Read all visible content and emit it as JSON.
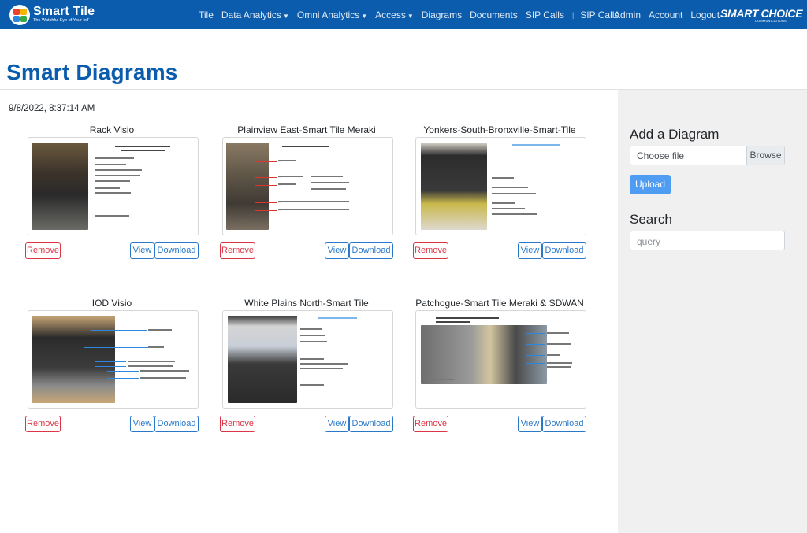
{
  "nav": {
    "brand_title": "Smart Tile",
    "brand_tagline": "The Watchful Eye of Your IoT",
    "links": [
      {
        "label": "Tile",
        "dropdown": false
      },
      {
        "label": "Data Analytics",
        "dropdown": true
      },
      {
        "label": "Omni Analytics",
        "dropdown": true
      },
      {
        "label": "Access",
        "dropdown": true
      },
      {
        "label": "Diagrams",
        "dropdown": false
      },
      {
        "label": "Documents",
        "dropdown": false
      },
      {
        "label": "SIP Calls",
        "dropdown": false
      },
      {
        "label": "SIP Calls",
        "dropdown": false
      }
    ],
    "right_links": [
      "Admin",
      "Account",
      "Logout"
    ],
    "partner_logo": "SMART CHOICE",
    "partner_sub": "COMMUNICATIONS"
  },
  "page": {
    "title": "Smart Diagrams",
    "timestamp": "9/8/2022, 8:37:14 AM"
  },
  "cards": [
    {
      "title": "Rack Visio",
      "remove": "Remove",
      "view": "View",
      "download": "Download"
    },
    {
      "title": "Plainview East-Smart Tile Meraki",
      "remove": "Remove",
      "view": "View",
      "download": "Download"
    },
    {
      "title": "Yonkers-South-Bronxville-Smart-Tile",
      "remove": "Remove",
      "view": "View",
      "download": "Download"
    },
    {
      "title": "IOD Visio",
      "remove": "Remove",
      "view": "View",
      "download": "Download"
    },
    {
      "title": "White Plains North-Smart Tile",
      "remove": "Remove",
      "view": "View",
      "download": "Download"
    },
    {
      "title": "Patchogue-Smart Tile Meraki & SDWAN",
      "remove": "Remove",
      "view": "View",
      "download": "Download"
    }
  ],
  "sidebar": {
    "add_heading": "Add a Diagram",
    "file_placeholder": "Choose file",
    "browse_label": "Browse",
    "upload_label": "Upload",
    "search_heading": "Search",
    "search_placeholder": "query"
  },
  "colors": {
    "navbar": "#0b5cad",
    "title": "#0b5cad",
    "danger": "#dc3545",
    "primary_outline": "#2a79c9",
    "upload": "#4f9cf3",
    "sidebar_bg": "#f0f0f0"
  }
}
